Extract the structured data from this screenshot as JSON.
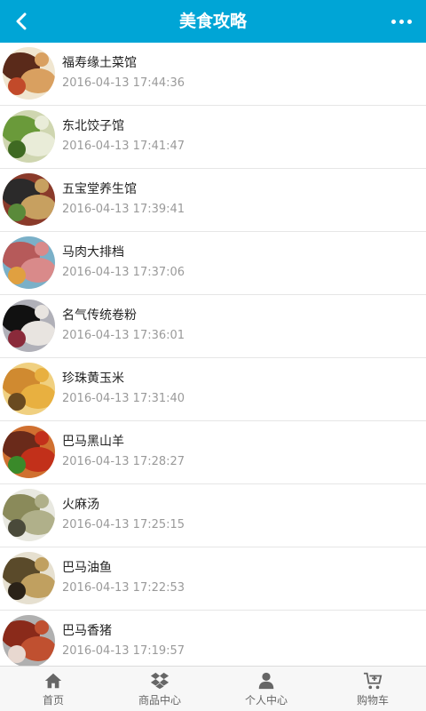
{
  "header": {
    "title": "美食攻略"
  },
  "items": [
    {
      "name": "福寿缘土菜馆",
      "time": "2016-04-13 17:44:36",
      "colors": [
        "#5a2a1a",
        "#d9a060",
        "#c24a2a",
        "#f0e6d0"
      ]
    },
    {
      "name": "东北饺子馆",
      "time": "2016-04-13 17:41:47",
      "colors": [
        "#6a9a3a",
        "#e9ecd8",
        "#3f6a22",
        "#cfd6b0"
      ]
    },
    {
      "name": "五宝堂养生馆",
      "time": "2016-04-13 17:39:41",
      "colors": [
        "#2b2a2a",
        "#c7a060",
        "#5a8a3a",
        "#8a3a2a"
      ]
    },
    {
      "name": "马肉大排档",
      "time": "2016-04-13 17:37:06",
      "colors": [
        "#b65a5a",
        "#d98a8a",
        "#e0a040",
        "#7ab0c8"
      ]
    },
    {
      "name": "名气传统卷粉",
      "time": "2016-04-13 17:36:01",
      "colors": [
        "#111111",
        "#e8e4e0",
        "#8a2a3a",
        "#b0b0b8"
      ]
    },
    {
      "name": "珍珠黄玉米",
      "time": "2016-04-13 17:31:40",
      "colors": [
        "#d08a30",
        "#e8b040",
        "#6a4a20",
        "#f0d080"
      ]
    },
    {
      "name": "巴马黑山羊",
      "time": "2016-04-13 17:28:27",
      "colors": [
        "#6a2a1a",
        "#c2301a",
        "#3a8a2a",
        "#d07030"
      ]
    },
    {
      "name": "火麻汤",
      "time": "2016-04-13 17:25:15",
      "colors": [
        "#8a8a5a",
        "#b0b08a",
        "#4a4a3a",
        "#e8e8e0"
      ]
    },
    {
      "name": "巴马油鱼",
      "time": "2016-04-13 17:22:53",
      "colors": [
        "#5a4a2a",
        "#c0a060",
        "#2a2218",
        "#e6e0d0"
      ]
    },
    {
      "name": "巴马香猪",
      "time": "2016-04-13 17:19:57",
      "colors": [
        "#8a2a1a",
        "#c05030",
        "#e8d8d0",
        "#b0b0b0"
      ]
    }
  ],
  "tabbar": [
    {
      "label": "首页",
      "icon": "home-icon"
    },
    {
      "label": "商品中心",
      "icon": "dropbox-icon"
    },
    {
      "label": "个人中心",
      "icon": "user-icon"
    },
    {
      "label": "购物车",
      "icon": "cart-icon"
    }
  ],
  "colors": {
    "accent": "#00a5d6"
  }
}
